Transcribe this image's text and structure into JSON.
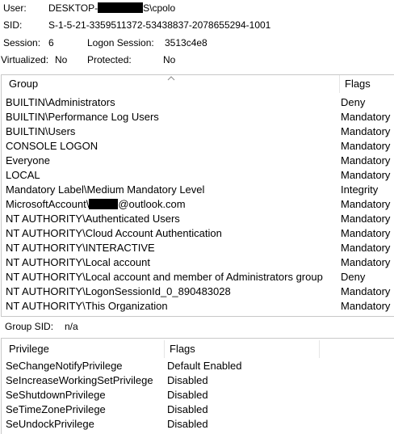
{
  "info": {
    "user_label": "User:",
    "user_value_prefix": "DESKTOP-",
    "user_value_suffix": "S\\cpolo",
    "sid_label": "SID:",
    "sid_value": "S-1-5-21-3359511372-53438837-2078655294-1001",
    "session_label": "Session:",
    "session_value": "6",
    "logon_session_label": "Logon Session:",
    "logon_session_value": "3513c4e8",
    "virtualized_label": "Virtualized:",
    "virtualized_value": "No",
    "protected_label": "Protected:",
    "protected_value": "No"
  },
  "groups_table": {
    "columns": [
      "Group",
      "Flags"
    ],
    "rows": [
      {
        "group": "BUILTIN\\Administrators",
        "flags": "Deny"
      },
      {
        "group": "BUILTIN\\Performance Log Users",
        "flags": "Mandatory"
      },
      {
        "group": "BUILTIN\\Users",
        "flags": "Mandatory"
      },
      {
        "group": "CONSOLE LOGON",
        "flags": "Mandatory"
      },
      {
        "group": "Everyone",
        "flags": "Mandatory"
      },
      {
        "group": "LOCAL",
        "flags": "Mandatory"
      },
      {
        "group": "Mandatory Label\\Medium Mandatory Level",
        "flags": "Integrity"
      },
      {
        "group_prefix": "MicrosoftAccount\\",
        "group_suffix": "@outlook.com",
        "flags": "Mandatory"
      },
      {
        "group": "NT AUTHORITY\\Authenticated Users",
        "flags": "Mandatory"
      },
      {
        "group": "NT AUTHORITY\\Cloud Account Authentication",
        "flags": "Mandatory"
      },
      {
        "group": "NT AUTHORITY\\INTERACTIVE",
        "flags": "Mandatory"
      },
      {
        "group": "NT AUTHORITY\\Local account",
        "flags": "Mandatory"
      },
      {
        "group": "NT AUTHORITY\\Local account and member of Administrators group",
        "flags": "Deny"
      },
      {
        "group": "NT AUTHORITY\\LogonSessionId_0_890483028",
        "flags": "Mandatory"
      },
      {
        "group": "NT AUTHORITY\\This Organization",
        "flags": "Mandatory"
      }
    ]
  },
  "group_sid": {
    "label": "Group SID:",
    "value": "n/a"
  },
  "privileges_table": {
    "columns": [
      "Privilege",
      "Flags"
    ],
    "rows": [
      {
        "privilege": "SeChangeNotifyPrivilege",
        "flags": "Default Enabled"
      },
      {
        "privilege": "SeIncreaseWorkingSetPrivilege",
        "flags": "Disabled"
      },
      {
        "privilege": "SeShutdownPrivilege",
        "flags": "Disabled"
      },
      {
        "privilege": "SeTimeZonePrivilege",
        "flags": "Disabled"
      },
      {
        "privilege": "SeUndockPrivilege",
        "flags": "Disabled"
      }
    ]
  }
}
